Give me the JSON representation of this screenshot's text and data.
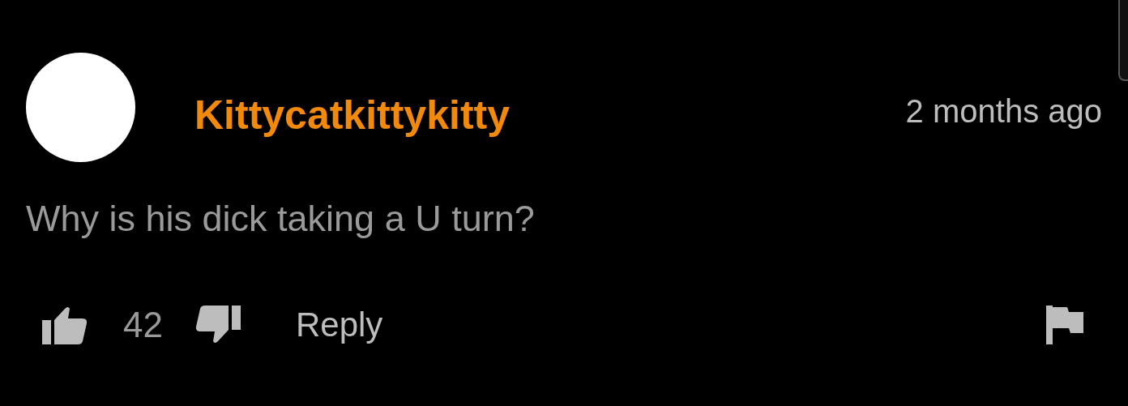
{
  "comment": {
    "author": "Kittycatkittykitty",
    "time": "2 months ago",
    "text": "Why is his dick taking a U turn?",
    "likes": "42",
    "reply": "Reply"
  }
}
